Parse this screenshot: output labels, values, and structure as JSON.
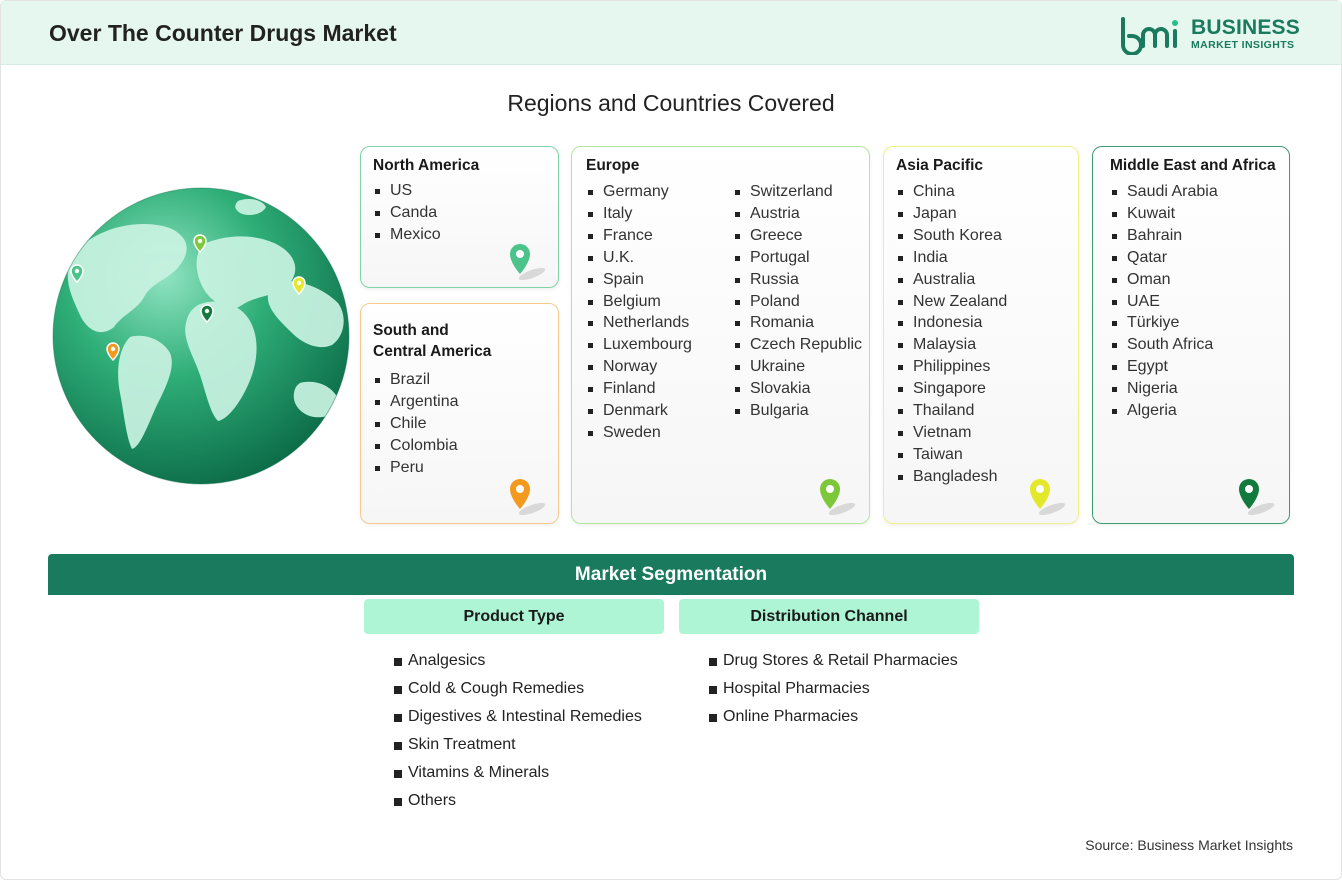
{
  "header": {
    "title": "Over The Counter Drugs Market",
    "logo_line1": "BUSINESS",
    "logo_line2": "MARKET INSIGHTS",
    "logo_mark": "bmi"
  },
  "regions_section": {
    "title": "Regions and Countries Covered",
    "regions": [
      {
        "name": "North America",
        "accent": "#7fd3a8",
        "pin_color": "#4cc38a",
        "countries": [
          "US",
          "Canda",
          "Mexico"
        ]
      },
      {
        "name": "South and\nCentral America",
        "name_line1": "South and",
        "name_line2": "Central America",
        "accent": "#f7c98d",
        "pin_color": "#f39a1e",
        "countries": [
          "Brazil",
          "Argentina",
          "Chile",
          "Colombia",
          "Peru"
        ]
      },
      {
        "name": "Europe",
        "accent": "#b5e59a",
        "pin_color": "#7cc83a",
        "countries_col1": [
          "Germany",
          "Italy",
          "France",
          "U.K.",
          "Spain",
          "Belgium",
          "Netherlands",
          "Luxembourg",
          "Norway",
          "Finland",
          "Denmark",
          "Sweden"
        ],
        "countries_col2": [
          "Switzerland",
          "Austria",
          "Greece",
          "Portugal",
          "Russia",
          "Poland",
          "Romania",
          "Czech Republic",
          "Ukraine",
          "Slovakia",
          "Bulgaria"
        ]
      },
      {
        "name": "Asia Pacific",
        "accent": "#eef08a",
        "pin_color": "#e3e82a",
        "countries": [
          "China",
          "Japan",
          "South Korea",
          "India",
          "Australia",
          "New Zealand",
          "Indonesia",
          "Malaysia",
          "Philippines",
          "Singapore",
          "Thailand",
          "Vietnam",
          "Taiwan",
          "Bangladesh"
        ]
      },
      {
        "name": "Middle East and Africa",
        "accent": "#3f9b72",
        "pin_color": "#137a3e",
        "countries": [
          "Saudi Arabia",
          "Kuwait",
          "Bahrain",
          "Qatar",
          "Oman",
          "UAE",
          "Türkiye",
          "South Africa",
          "Egypt",
          "Nigeria",
          "Algeria"
        ]
      }
    ]
  },
  "segmentation": {
    "title": "Market Segmentation",
    "columns": [
      {
        "heading": "Product Type",
        "items": [
          "Analgesics",
          "Cold & Cough Remedies",
          "Digestives & Intestinal Remedies",
          "Skin Treatment",
          "Vitamins & Minerals",
          "Others"
        ]
      },
      {
        "heading": "Distribution Channel",
        "items": [
          "Drug Stores & Retail Pharmacies",
          "Hospital Pharmacies",
          "Online Pharmacies"
        ]
      }
    ]
  },
  "source": "Source: Business Market Insights",
  "colors": {
    "brand": "#1a7a5e",
    "header_bg": "#e6f7ef",
    "segment_head_bg": "#aef5d6"
  }
}
